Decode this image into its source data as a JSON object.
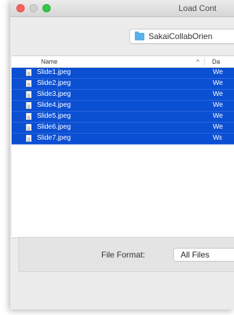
{
  "window": {
    "title": "Load Cont"
  },
  "toolbar": {
    "location_label": "SakaiCollabOrien",
    "location_icon": "folder-icon"
  },
  "file_list": {
    "columns": {
      "name": "Name",
      "date": "Da",
      "sort_indicator": "^"
    },
    "rows": [
      {
        "name": "Slide1.jpeg",
        "date": "We"
      },
      {
        "name": "Slide2.jpeg",
        "date": "We"
      },
      {
        "name": "Slide3.jpeg",
        "date": "We"
      },
      {
        "name": "Slide4.jpeg",
        "date": "We"
      },
      {
        "name": "Slide5.jpeg",
        "date": "We"
      },
      {
        "name": "Slide6.jpeg",
        "date": "We"
      },
      {
        "name": "Slide7.jpeg",
        "date": "Wε"
      }
    ],
    "selection_color": "#0b4fd3"
  },
  "format": {
    "label": "File Format:",
    "value": "All Files"
  },
  "colors": {
    "close": "#fc615d",
    "minimize": "#d0d0d0",
    "zoom": "#34c749",
    "folder": "#5ab1e8"
  }
}
